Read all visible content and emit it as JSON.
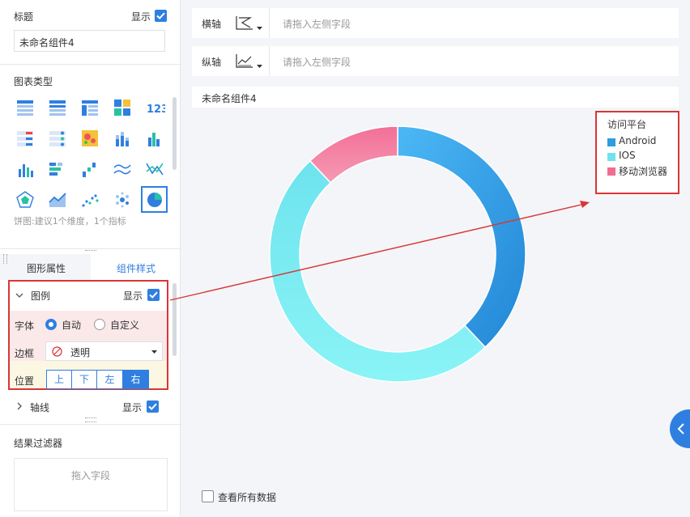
{
  "sidebar": {
    "title_label": "标题",
    "title_show_label": "显示",
    "title_value": "未命名组件4",
    "chart_type_label": "图表类型",
    "chart_type_hint": "饼图:建议1个维度，1个指标",
    "tabs": [
      "图形属性",
      "组件样式"
    ],
    "legend": {
      "label": "图例",
      "show_label": "显示",
      "font_label": "字体",
      "font_options": [
        "自动",
        "自定义"
      ],
      "border_label": "边框",
      "border_value": "透明",
      "position_label": "位置",
      "position_options": [
        "上",
        "下",
        "左",
        "右"
      ],
      "position_selected": "右"
    },
    "axis": {
      "label": "轴线",
      "show_label": "显示"
    },
    "filter_label": "结果过滤器",
    "filter_drop_hint": "拖入字段"
  },
  "axes": {
    "x_label": "横轴",
    "y_label": "纵轴",
    "x_placeholder": "请拖入左侧字段",
    "y_placeholder": "请拖入左侧字段"
  },
  "chart_title": "未命名组件4",
  "view_all_label": "查看所有数据",
  "chart_data": {
    "type": "pie",
    "title": "未命名组件4",
    "legend_title": "访问平台",
    "legend_position": "right",
    "categories": [
      "Android",
      "IOS",
      "移动浏览器"
    ],
    "values": [
      38,
      50,
      12
    ],
    "colors": [
      "#2f9be0",
      "#6ee3ee",
      "#f06d92"
    ]
  }
}
